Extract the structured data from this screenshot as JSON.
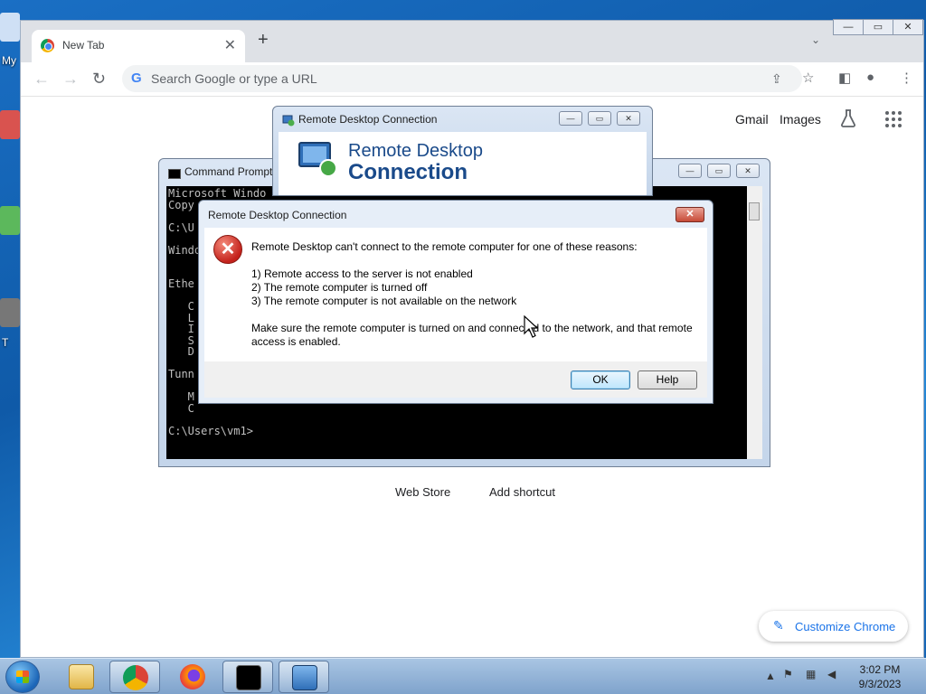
{
  "desktop": {
    "labels": [
      "My",
      "T"
    ]
  },
  "browser": {
    "tab_title": "New Tab",
    "tab_close": "✕",
    "new_tab": "+",
    "tab_search": "⌄",
    "window_controls": [
      "—",
      "▭",
      "✕"
    ],
    "omnibox_placeholder": "Search Google or type a URL",
    "omnibox_g": "G",
    "ntp": {
      "gmail": "Gmail",
      "images": "Images",
      "shortcuts": [
        "Web Store",
        "Add shortcut"
      ],
      "customize_label": "Customize Chrome",
      "customize_icon": "✎"
    }
  },
  "cmd_window": {
    "title": "Command Prompt",
    "console_lines": [
      "Microsoft Windo",
      "Copy",
      "",
      "C:\\U",
      "",
      "Windo",
      "",
      "",
      "Ethe",
      "",
      "   C",
      "   L",
      "   I",
      "   S",
      "   D",
      "",
      "Tunn",
      "",
      "   M",
      "   C",
      "",
      "C:\\Users\\vm1>"
    ],
    "controls": [
      "—",
      "▭",
      "✕"
    ]
  },
  "rdc_window": {
    "title": "Remote Desktop Connection",
    "banner_line1": "Remote Desktop",
    "banner_line2": "Connection",
    "controls": [
      "—",
      "▭",
      "✕"
    ]
  },
  "error_dialog": {
    "title": "Remote Desktop Connection",
    "close": "✕",
    "icon_glyph": "✕",
    "message": "Remote Desktop can't connect to the remote computer for one of these reasons:",
    "reasons": [
      "1) Remote access to the server is not enabled",
      "2) The remote computer is turned off",
      "3) The remote computer is not available on the network"
    ],
    "advice_line1": "Make sure the remote computer is turned on and connected to the network, and that remote",
    "advice_line2": "access is enabled.",
    "ok_label": "OK",
    "help_label": "Help"
  },
  "taskbar": {
    "items": [
      "explorer",
      "chrome",
      "firefox",
      "cmd",
      "remote-desktop"
    ],
    "tray_arrow": "▲",
    "time": "3:02 PM",
    "date": "9/3/2023"
  },
  "colors": {
    "desktop_bg": "#1a6fc4",
    "chrome_accent": "#1a73e8",
    "error_red": "#c4221c",
    "rdc_blue": "#1a4a8a"
  }
}
